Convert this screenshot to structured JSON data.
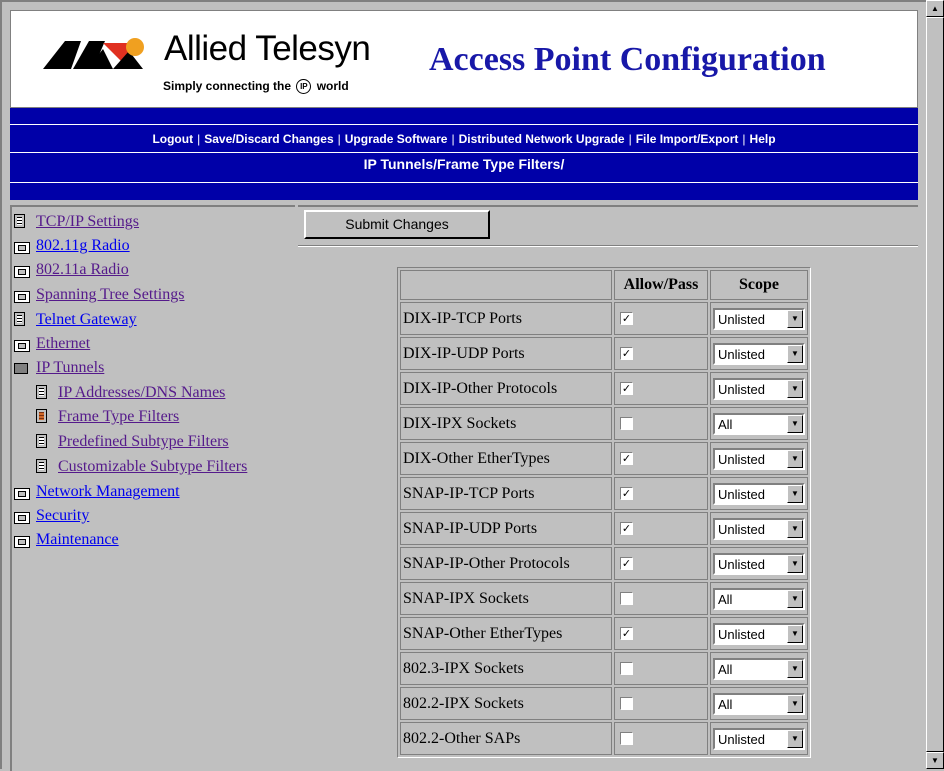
{
  "header": {
    "brand_name": "Allied Telesyn",
    "tagline_pre": "Simply connecting the",
    "tagline_ip": "IP",
    "tagline_post": "world",
    "title": "Access Point Configuration"
  },
  "nav": {
    "links": [
      "Logout",
      "Save/Discard Changes",
      "Upgrade Software",
      "Distributed Network Upgrade",
      "File Import/Export",
      "Help"
    ],
    "breadcrumb": "IP Tunnels/Frame Type Filters/"
  },
  "sidebar": {
    "items": [
      {
        "label": "TCP/IP Settings",
        "icon": "document-icon"
      },
      {
        "label": "802.11g Radio",
        "icon": "folder-closed-icon"
      },
      {
        "label": "802.11a Radio",
        "icon": "folder-closed-icon"
      },
      {
        "label": "Spanning Tree Settings",
        "icon": "folder-closed-icon"
      },
      {
        "label": "Telnet Gateway",
        "icon": "document-icon"
      },
      {
        "label": "Ethernet",
        "icon": "folder-closed-icon"
      },
      {
        "label": "IP Tunnels",
        "icon": "folder-open-icon"
      },
      {
        "label": "IP Addresses/DNS Names",
        "icon": "document-icon"
      },
      {
        "label": "Frame Type Filters",
        "icon": "document-selected-icon"
      },
      {
        "label": "Predefined Subtype Filters",
        "icon": "document-icon"
      },
      {
        "label": "Customizable Subtype Filters",
        "icon": "document-icon"
      },
      {
        "label": "Network Management",
        "icon": "folder-closed-icon"
      },
      {
        "label": "Security",
        "icon": "folder-closed-icon"
      },
      {
        "label": "Maintenance",
        "icon": "folder-closed-icon"
      }
    ]
  },
  "content": {
    "submit_label": "Submit Changes",
    "columns": [
      "",
      "Allow/Pass",
      "Scope"
    ],
    "rows": [
      {
        "name": "DIX-IP-TCP Ports",
        "allow": true,
        "scope": "Unlisted"
      },
      {
        "name": "DIX-IP-UDP Ports",
        "allow": true,
        "scope": "Unlisted"
      },
      {
        "name": "DIX-IP-Other Protocols",
        "allow": true,
        "scope": "Unlisted"
      },
      {
        "name": "DIX-IPX Sockets",
        "allow": false,
        "scope": "All"
      },
      {
        "name": "DIX-Other EtherTypes",
        "allow": true,
        "scope": "Unlisted"
      },
      {
        "name": "SNAP-IP-TCP Ports",
        "allow": true,
        "scope": "Unlisted"
      },
      {
        "name": "SNAP-IP-UDP Ports",
        "allow": true,
        "scope": "Unlisted"
      },
      {
        "name": "SNAP-IP-Other Protocols",
        "allow": true,
        "scope": "Unlisted"
      },
      {
        "name": "SNAP-IPX Sockets",
        "allow": false,
        "scope": "All"
      },
      {
        "name": "SNAP-Other EtherTypes",
        "allow": true,
        "scope": "Unlisted"
      },
      {
        "name": "802.3-IPX Sockets",
        "allow": false,
        "scope": "All"
      },
      {
        "name": "802.2-IPX Sockets",
        "allow": false,
        "scope": "All"
      },
      {
        "name": "802.2-Other SAPs",
        "allow": false,
        "scope": "Unlisted"
      }
    ]
  },
  "colors": {
    "nav_bg": "#0000a8",
    "title_blue": "#1818a8",
    "visited_link": "#551a8b",
    "link": "#0000ee",
    "window_bg": "#c0c0c0"
  }
}
